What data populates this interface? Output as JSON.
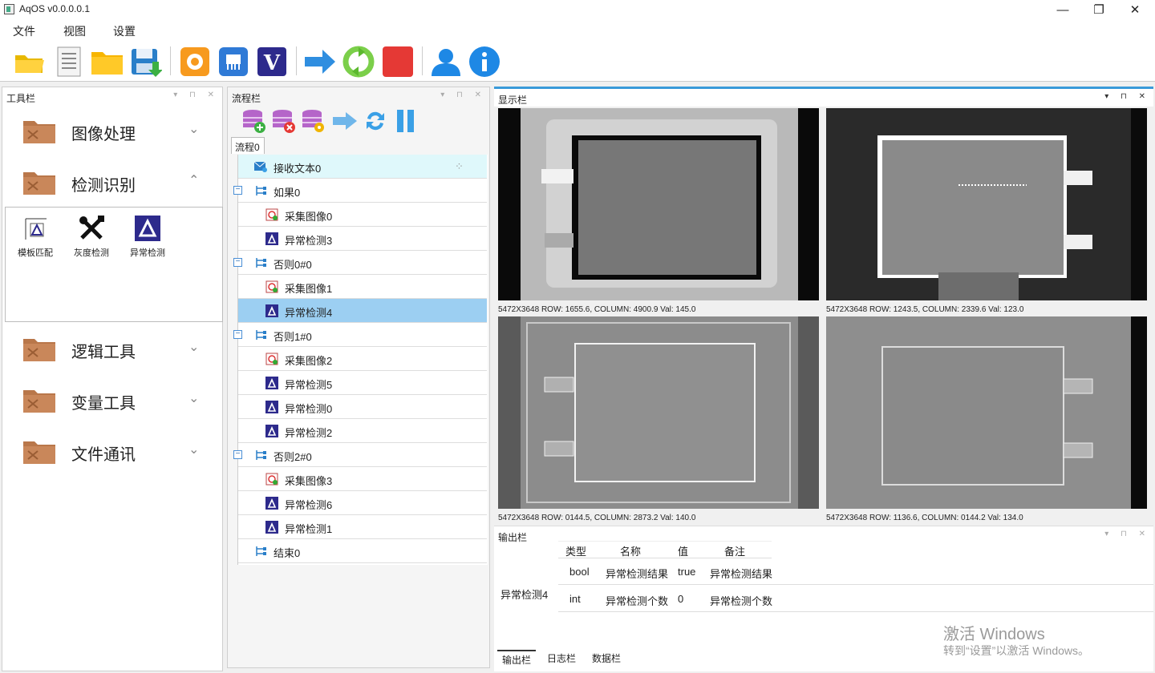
{
  "window": {
    "title": "AqOS v0.0.0.0.1",
    "min": "—",
    "restore": "❐",
    "close": "✕"
  },
  "menu": [
    "文件",
    "视图",
    "设置"
  ],
  "toolbar_icons": [
    "open-folder-icon",
    "document-icon",
    "folder-icon",
    "save-icon",
    "camera-icon",
    "network-icon",
    "vision-icon",
    "run-arrow-icon",
    "recycle-icon",
    "stop-icon",
    "user-icon",
    "info-icon"
  ],
  "tool_panel": {
    "title": "工具栏",
    "categories": [
      {
        "label": "图像处理",
        "chevron": "⌄"
      },
      {
        "label": "检测识别",
        "chevron": "⌃"
      },
      {
        "label": "逻辑工具",
        "chevron": "⌄"
      },
      {
        "label": "变量工具",
        "chevron": "⌄"
      },
      {
        "label": "文件通讯",
        "chevron": "⌄"
      }
    ],
    "tools": [
      "模板匹配",
      "灰度检测",
      "异常检测"
    ]
  },
  "flow_panel": {
    "title": "流程栏",
    "tab": "流程0",
    "rows": [
      {
        "label": "接收文本0",
        "icon": "message-icon"
      },
      {
        "label": "如果0",
        "icon": "branch-icon"
      },
      {
        "label": "采集图像0",
        "icon": "capture-icon"
      },
      {
        "label": "异常检测3",
        "icon": "anomaly-icon"
      },
      {
        "label": "否则0#0",
        "icon": "branch-icon"
      },
      {
        "label": "采集图像1",
        "icon": "capture-icon"
      },
      {
        "label": "异常检测4",
        "icon": "anomaly-icon"
      },
      {
        "label": "否则1#0",
        "icon": "branch-icon"
      },
      {
        "label": "采集图像2",
        "icon": "capture-icon"
      },
      {
        "label": "异常检测5",
        "icon": "anomaly-icon"
      },
      {
        "label": "异常检测0",
        "icon": "anomaly-icon"
      },
      {
        "label": "异常检测2",
        "icon": "anomaly-icon"
      },
      {
        "label": "否则2#0",
        "icon": "branch-icon"
      },
      {
        "label": "采集图像3",
        "icon": "capture-icon"
      },
      {
        "label": "异常检测6",
        "icon": "anomaly-icon"
      },
      {
        "label": "异常检测1",
        "icon": "anomaly-icon"
      },
      {
        "label": "结束0",
        "icon": "branch-icon"
      }
    ]
  },
  "display_panel": {
    "title": "显示栏",
    "cams": [
      {
        "info": "5472X3648    ROW: 1655.6, COLUMN: 4900.9    Val: 145.0"
      },
      {
        "info": "5472X3648    ROW: 1243.5, COLUMN: 2339.6    Val: 123.0"
      },
      {
        "info": "5472X3648    ROW: 0144.5, COLUMN: 2873.2    Val: 140.0"
      },
      {
        "info": "5472X3648    ROW: 1136.6, COLUMN: 0144.2    Val: 134.0"
      }
    ]
  },
  "output_panel": {
    "title": "输出栏",
    "headers": [
      "类型",
      "名称",
      "值",
      "备注"
    ],
    "group": "异常检测4",
    "rows": [
      {
        "type": "bool",
        "name": "异常检测结果",
        "value": "true",
        "note": "异常检测结果"
      },
      {
        "type": "int",
        "name": "异常检测个数",
        "value": "0",
        "note": "异常检测个数"
      }
    ],
    "tabs": [
      "输出栏",
      "日志栏",
      "数据栏"
    ]
  },
  "watermark": {
    "line1": "激活 Windows",
    "line2": "转到“设置”以激活 Windows。"
  }
}
